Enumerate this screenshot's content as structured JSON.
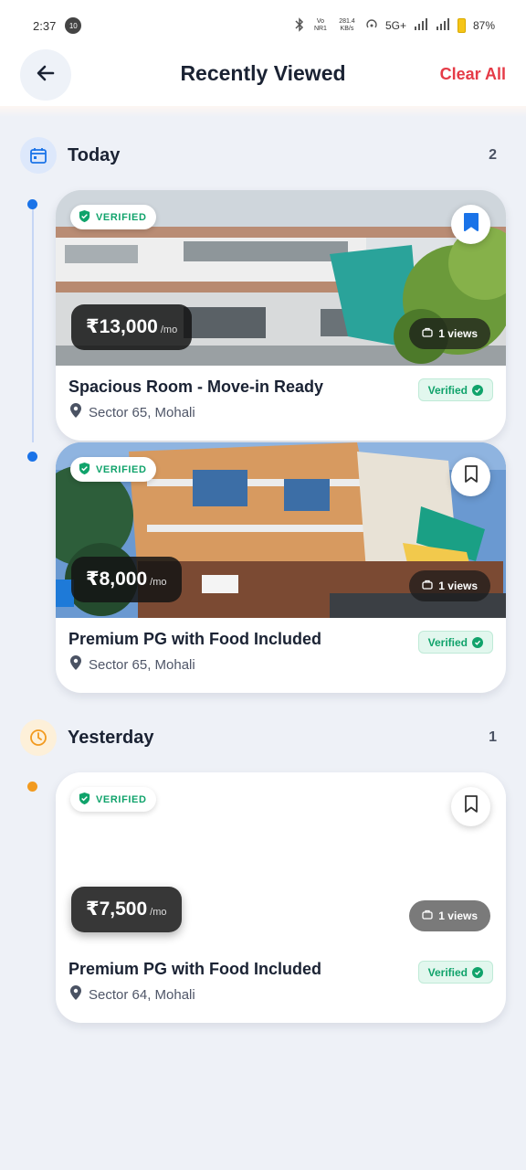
{
  "status_bar": {
    "time": "2:37",
    "notification_count": "10",
    "volte": "Vo NR1",
    "speed": "281.4 KB/s",
    "network": "5G+",
    "battery": "87%"
  },
  "header": {
    "title": "Recently Viewed",
    "clear_label": "Clear All",
    "back_icon": "arrow-left-icon"
  },
  "sections": [
    {
      "title": "Today",
      "count": "2",
      "icon": "calendar-icon",
      "accent": "#1a73e8"
    },
    {
      "title": "Yesterday",
      "count": "1",
      "icon": "clock-icon",
      "accent": "#f29a1f"
    }
  ],
  "listings": [
    {
      "verified_tag": "VERIFIED",
      "price": "₹13,000",
      "per": "/mo",
      "views": "1 views",
      "title": "Spacious Room - Move-in Ready",
      "location": "Sector 65, Mohali",
      "badge": "Verified",
      "bookmarked": true
    },
    {
      "verified_tag": "VERIFIED",
      "price": "₹8,000",
      "per": "/mo",
      "views": "1 views",
      "title": "Premium PG with Food Included",
      "location": "Sector 65, Mohali",
      "badge": "Verified",
      "bookmarked": false
    },
    {
      "verified_tag": "VERIFIED",
      "price": "₹7,500",
      "per": "/mo",
      "views": "1 views",
      "title": "Premium PG with Food Included",
      "location": "Sector 64, Mohali",
      "badge": "Verified",
      "bookmarked": false
    }
  ],
  "colors": {
    "accent_blue": "#1a73e8",
    "danger_red": "#e53b47",
    "verified_green": "#10a36b",
    "background": "#eef1f7"
  }
}
